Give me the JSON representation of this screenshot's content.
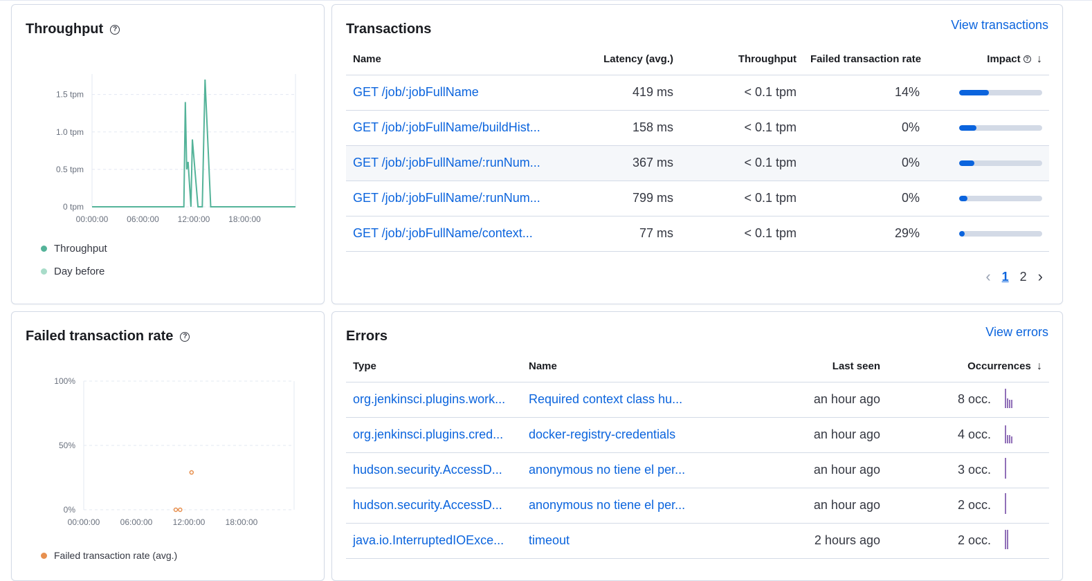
{
  "throughput": {
    "title": "Throughput",
    "y_ticks": [
      "1.5 tpm",
      "1.0 tpm",
      "0.5 tpm",
      "0 tpm"
    ],
    "x_ticks": [
      "00:00:00",
      "06:00:00",
      "12:00:00",
      "18:00:00"
    ],
    "legend": [
      {
        "label": "Throughput",
        "color": "#54b399"
      },
      {
        "label": "Day before",
        "color": "#a8dcc9"
      }
    ]
  },
  "transactions": {
    "title": "Transactions",
    "view_link": "View transactions",
    "columns": [
      "Name",
      "Latency (avg.)",
      "Throughput",
      "Failed transaction rate",
      "Impact"
    ],
    "rows": [
      {
        "name": "GET /job/:jobFullName",
        "latency": "419 ms",
        "throughput": "< 0.1 tpm",
        "failed": "14%",
        "impact": 0.36
      },
      {
        "name": "GET /job/:jobFullName/buildHist...",
        "latency": "158 ms",
        "throughput": "< 0.1 tpm",
        "failed": "0%",
        "impact": 0.21
      },
      {
        "name": "GET /job/:jobFullName/:runNum...",
        "latency": "367 ms",
        "throughput": "< 0.1 tpm",
        "failed": "0%",
        "impact": 0.18
      },
      {
        "name": "GET /job/:jobFullName/:runNum...",
        "latency": "799 ms",
        "throughput": "< 0.1 tpm",
        "failed": "0%",
        "impact": 0.1
      },
      {
        "name": "GET /job/:jobFullName/context...",
        "latency": "77 ms",
        "throughput": "< 0.1 tpm",
        "failed": "29%",
        "impact": 0.07
      }
    ],
    "pages": [
      "1",
      "2"
    ],
    "current_page": "1"
  },
  "failed_rate": {
    "title": "Failed transaction rate",
    "y_ticks": [
      "100%",
      "50%",
      "0%"
    ],
    "x_ticks": [
      "00:00:00",
      "06:00:00",
      "12:00:00",
      "18:00:00"
    ],
    "legend": [
      {
        "label": "Failed transaction rate (avg.)",
        "color": "#e7904f"
      }
    ]
  },
  "errors": {
    "title": "Errors",
    "view_link": "View errors",
    "columns": [
      "Type",
      "Name",
      "Last seen",
      "Occurrences"
    ],
    "rows": [
      {
        "type": "org.jenkinsci.plugins.work...",
        "name": "Required context class hu...",
        "last_seen": "an hour ago",
        "occ": "8 occ."
      },
      {
        "type": "org.jenkinsci.plugins.cred...",
        "name": "docker-registry-credentials",
        "last_seen": "an hour ago",
        "occ": "4 occ."
      },
      {
        "type": "hudson.security.AccessD...",
        "name": "anonymous no tiene el per...",
        "last_seen": "an hour ago",
        "occ": "3 occ."
      },
      {
        "type": "hudson.security.AccessD...",
        "name": "anonymous no tiene el per...",
        "last_seen": "an hour ago",
        "occ": "2 occ."
      },
      {
        "type": "java.io.InterruptedIOExce...",
        "name": "timeout",
        "last_seen": "2 hours ago",
        "occ": "2 occ."
      }
    ]
  },
  "chart_data": [
    {
      "type": "line",
      "title": "Throughput",
      "ylim": [
        0,
        1.5
      ],
      "x": [
        "00:00",
        "10:50",
        "11:00",
        "11:10",
        "11:20",
        "11:40",
        "11:50",
        "12:30",
        "13:00",
        "13:20",
        "14:00",
        "24:00"
      ],
      "series": [
        {
          "name": "Throughput",
          "values": [
            0,
            0,
            1.4,
            0.5,
            0.6,
            0,
            0.9,
            0,
            0,
            1.7,
            0,
            0
          ]
        }
      ],
      "xlabel": "",
      "ylabel": ""
    },
    {
      "type": "scatter",
      "title": "Failed transaction rate",
      "ylim": [
        0,
        100
      ],
      "series": [
        {
          "name": "Failed transaction rate (avg.)",
          "points": [
            [
              10.5,
              0
            ],
            [
              11.0,
              0
            ],
            [
              12.3,
              29
            ]
          ]
        }
      ],
      "xlabel": "",
      "ylabel": ""
    }
  ]
}
